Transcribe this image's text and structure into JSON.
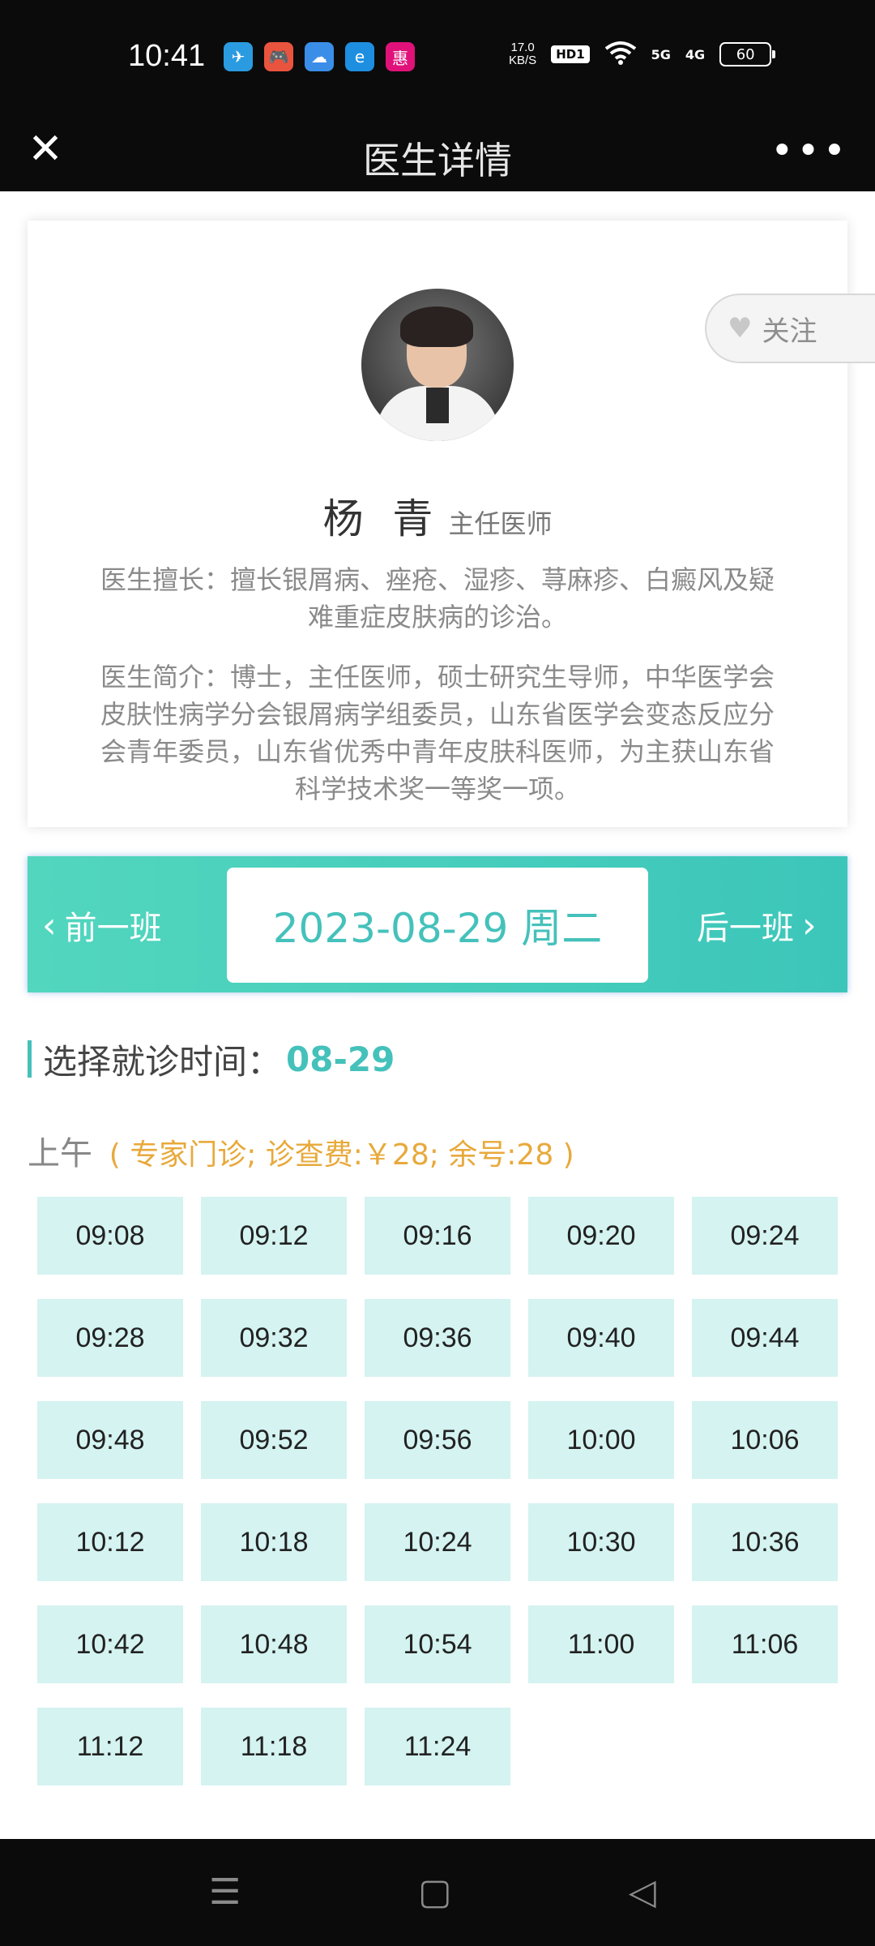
{
  "status_bar": {
    "time": "10:41",
    "apps": [
      {
        "icon": "telegram-icon",
        "glyph": "✈",
        "color": "#2a9be0"
      },
      {
        "icon": "game-icon",
        "glyph": "🎮",
        "color": "#e9543f"
      },
      {
        "icon": "weather-icon",
        "glyph": "☁",
        "color": "#3a8ee8"
      },
      {
        "icon": "browser-icon",
        "glyph": "e",
        "color": "#1e8fe0"
      },
      {
        "icon": "shop-icon",
        "glyph": "惠",
        "color": "#e0127a"
      }
    ],
    "speed": "17.0\nKB/S",
    "hd": "HD1",
    "wifi": "wifi",
    "net1": "5G",
    "net2": "4G",
    "battery": "60"
  },
  "header": {
    "title": "医生详情",
    "close_glyph": "✕",
    "more_glyph": "•••"
  },
  "doctor": {
    "follow_label": "关注",
    "name": "杨 青",
    "title": "主任医师",
    "specialty": "医生擅长：擅长银屑病、痤疮、湿疹、荨麻疹、白癜风及疑难重症皮肤病的诊治。",
    "intro": "医生简介：博士，主任医师，硕士研究生导师，中华医学会皮肤性病学分会银屑病学组委员，山东省医学会变态反应分会青年委员，山东省优秀中青年皮肤科医师，为主获山东省科学技术奖一等奖一项。"
  },
  "schedule": {
    "prev_label": "前一班",
    "next_label": "后一班",
    "current_date": "2023-08-29 周二",
    "select_label": "选择就诊时间：",
    "select_date": "08-29",
    "session_name": "上午",
    "session_info": "( 专家门诊;  诊查费:￥28;  余号:28 )",
    "slots": [
      "09:08",
      "09:12",
      "09:16",
      "09:20",
      "09:24",
      "09:28",
      "09:32",
      "09:36",
      "09:40",
      "09:44",
      "09:48",
      "09:52",
      "09:56",
      "10:00",
      "10:06",
      "10:12",
      "10:18",
      "10:24",
      "10:30",
      "10:36",
      "10:42",
      "10:48",
      "10:54",
      "11:00",
      "11:06",
      "11:12",
      "11:18",
      "11:24"
    ]
  },
  "nav": {
    "menu_glyph": "☰",
    "home_glyph": "▢",
    "back_glyph": "◁"
  }
}
